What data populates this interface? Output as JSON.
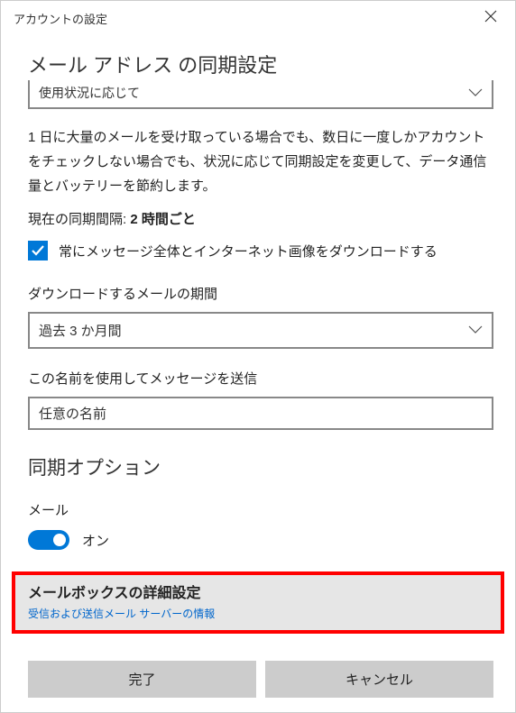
{
  "titlebar": {
    "title": "アカウントの設定"
  },
  "headings": {
    "sync": "メール アドレス の同期設定",
    "options": "同期オプション"
  },
  "usage_dropdown": {
    "value": "使用状況に応じて"
  },
  "description": "1 日に大量のメールを受け取っている場合でも、数日に一度しかアカウントをチェックしない場合でも、状況に応じて同期設定を変更して、データ通信量とバッテリーを節約します。",
  "interval": {
    "label": "現在の同期間隔:",
    "value": "2 時間ごと"
  },
  "checkbox": {
    "label": "常にメッセージ全体とインターネット画像をダウンロードする"
  },
  "download_period": {
    "label": "ダウンロードするメールの期間",
    "value": "過去 3 か月間"
  },
  "send_name": {
    "label": "この名前を使用してメッセージを送信",
    "value": "任意の名前"
  },
  "mail_toggle": {
    "label": "メール",
    "state": "オン"
  },
  "advanced": {
    "title": "メールボックスの詳細設定",
    "subtitle": "受信および送信メール サーバーの情報"
  },
  "buttons": {
    "done": "完了",
    "cancel": "キャンセル"
  }
}
